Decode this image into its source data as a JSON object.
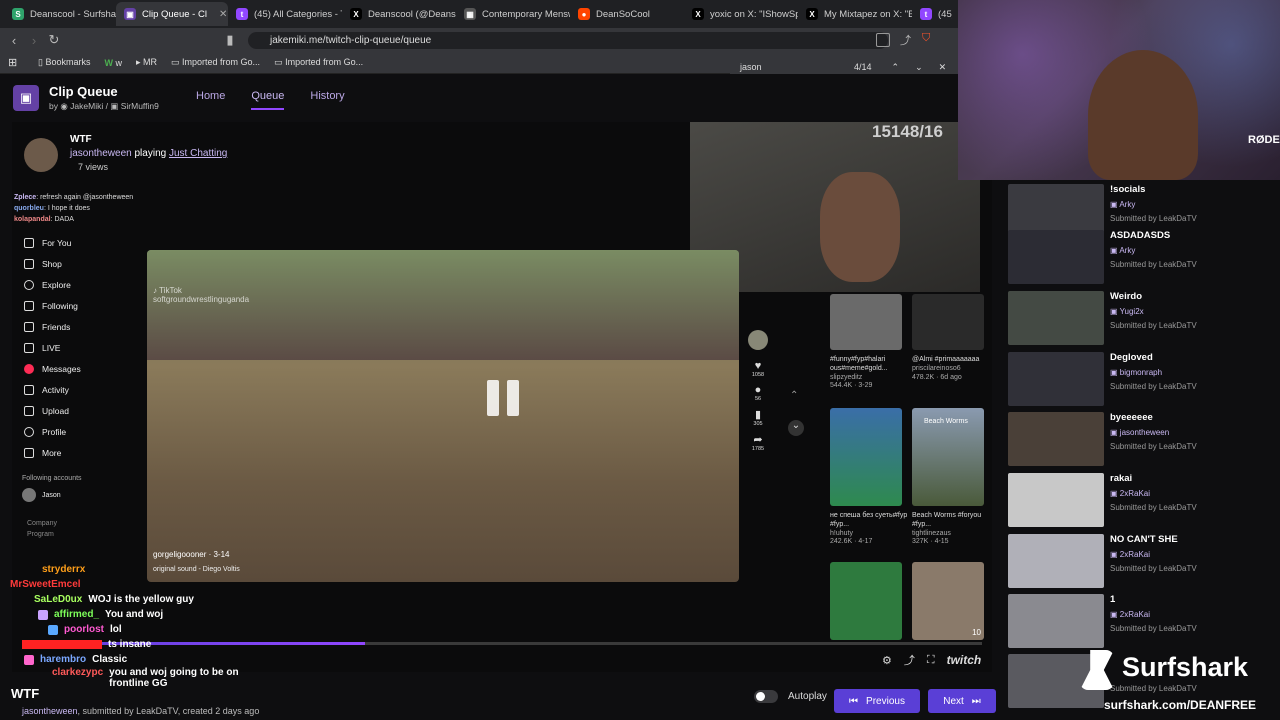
{
  "tabs": [
    {
      "label": "Deanscool - Surfshark",
      "color": "#2fa36b"
    },
    {
      "label": "Clip Queue - Cl",
      "color": "#6441a5",
      "active": true
    },
    {
      "label": "(45) All Categories - Tw",
      "color": "#9147ff"
    },
    {
      "label": "Deanscool (@Deans",
      "color": "#000000"
    },
    {
      "label": "Contemporary Menswe",
      "color": "#555555"
    },
    {
      "label": "DeanSoCool",
      "color": "#ff4500"
    },
    {
      "label": "yoxic on X: \"IShowSpe",
      "color": "#000000"
    },
    {
      "label": "My Mixtapez on X: \"Be",
      "color": "#000000"
    },
    {
      "label": "(45) K",
      "color": "#9147ff"
    }
  ],
  "browser": {
    "url": "jakemiki.me/twitch-clip-queue/queue",
    "bookmarks": [
      "Bookmarks",
      "w",
      "MR",
      "Imported from Go...",
      "Imported from Go..."
    ],
    "find": {
      "query": "jason",
      "count": "4/14"
    }
  },
  "app": {
    "title": "Clip Queue",
    "by_label": "by",
    "author1": "JakeMiki",
    "author2": "SirMuffin9",
    "nav": [
      "Home",
      "Queue",
      "History"
    ]
  },
  "video": {
    "streamer_top": "WTF",
    "playing_user": "jasontheween",
    "playing_label": "playing",
    "category": "Just Chatting",
    "views": "7 views",
    "counter": "15148/16",
    "tiktok_user": "softgroundwrestlinguganda",
    "tiktok_author": "gorgeligoooner · 3-14",
    "tiktok_sound": "original sound - Diego Voltis",
    "sidebar": [
      "For You",
      "Shop",
      "Explore",
      "Following",
      "Friends",
      "LIVE",
      "Messages",
      "Activity",
      "Upload",
      "Profile",
      "More"
    ],
    "following_accounts": "Following accounts",
    "following_name": "Jason",
    "footer_items": [
      "Company",
      "Program"
    ],
    "actions": [
      "1058",
      "56",
      "305",
      "1785"
    ],
    "grid": [
      {
        "caption": "#funny#fyp#halari ous#meme#gold...",
        "author": "slipzyeditz",
        "stats": "544.4K · 3-29"
      },
      {
        "caption": "@Almi #primaaaaaaa",
        "author": "priscilareinoso6",
        "stats": "478.2K · 6d ago"
      },
      {
        "caption": "не спеша без суеты#fyp #fyp...",
        "author": "h!uhuty",
        "stats": "242.6K · 4-17"
      },
      {
        "caption": "Beach Worms #foryou #fyp...",
        "author": "tightlinezaus",
        "stats": "327K · 4-15"
      }
    ],
    "grid_extra_label": "Beach Worms",
    "grid_badge": "10",
    "old_chat": [
      {
        "user": "Zplece",
        "msg": "refresh again @jasontheween"
      },
      {
        "user": "quorbleu",
        "msg": "I hope it does"
      },
      {
        "user": "kolapandal",
        "msg": "DADA"
      }
    ],
    "twitch_label": "twitch"
  },
  "chat": [
    {
      "user": "stryderrx",
      "color": "#ff9f1a",
      "msg": ""
    },
    {
      "user": "MrSweetEmcel",
      "color": "#ff3b3b",
      "msg": ""
    },
    {
      "user": "SaLeD0ux",
      "color": "#a8ff60",
      "msg": "WOJ is the yellow guy"
    },
    {
      "user": "affirmed_",
      "color": "#7dff5a",
      "msg": "You and woj"
    },
    {
      "user": "poorlost",
      "color": "#ff5ad1",
      "msg": "lol"
    },
    {
      "user": "",
      "color": "#ff2222",
      "msg": "ts insane"
    },
    {
      "user": "harembro",
      "color": "#7aa7ff",
      "msg": "Classic"
    },
    {
      "user": "clarkezypc",
      "color": "#ff5a5a",
      "msg": "you and woj going to be on frontline GG"
    }
  ],
  "clip": {
    "title": "WTF",
    "creator": "jasontheween",
    "meta": ", submitted by LeakDaTV, created 2 days ago"
  },
  "controls": {
    "autoplay": "Autoplay",
    "previous": "Previous",
    "next": "Next"
  },
  "queue": [
    {
      "title": "!socials",
      "channel": "Arky",
      "submitted": "Submitted by LeakDaTV"
    },
    {
      "title": "ASDADASDS",
      "channel": "Arky",
      "submitted": "Submitted by LeakDaTV"
    },
    {
      "title": "Weirdo",
      "channel": "Yugi2x",
      "submitted": "Submitted by LeakDaTV"
    },
    {
      "title": "Degloved",
      "channel": "bigmonraph",
      "submitted": "Submitted by LeakDaTV"
    },
    {
      "title": "byeeeeee",
      "channel": "jasontheween",
      "submitted": "Submitted by LeakDaTV"
    },
    {
      "title": "rakai",
      "channel": "2xRaKai",
      "submitted": "Submitted by LeakDaTV"
    },
    {
      "title": "NO CAN'T SHE",
      "channel": "2xRaKai",
      "submitted": "Submitted by LeakDaTV"
    },
    {
      "title": "1",
      "channel": "2xRaKai",
      "submitted": "Submitted by LeakDaTV"
    },
    {
      "title": "",
      "channel": "",
      "submitted": "Submitted by LeakDaTV"
    }
  ],
  "sponsor": {
    "brand": "Surfshark",
    "url": "surfshark.com/DEANFREE"
  },
  "webcam_label": "RØDE"
}
